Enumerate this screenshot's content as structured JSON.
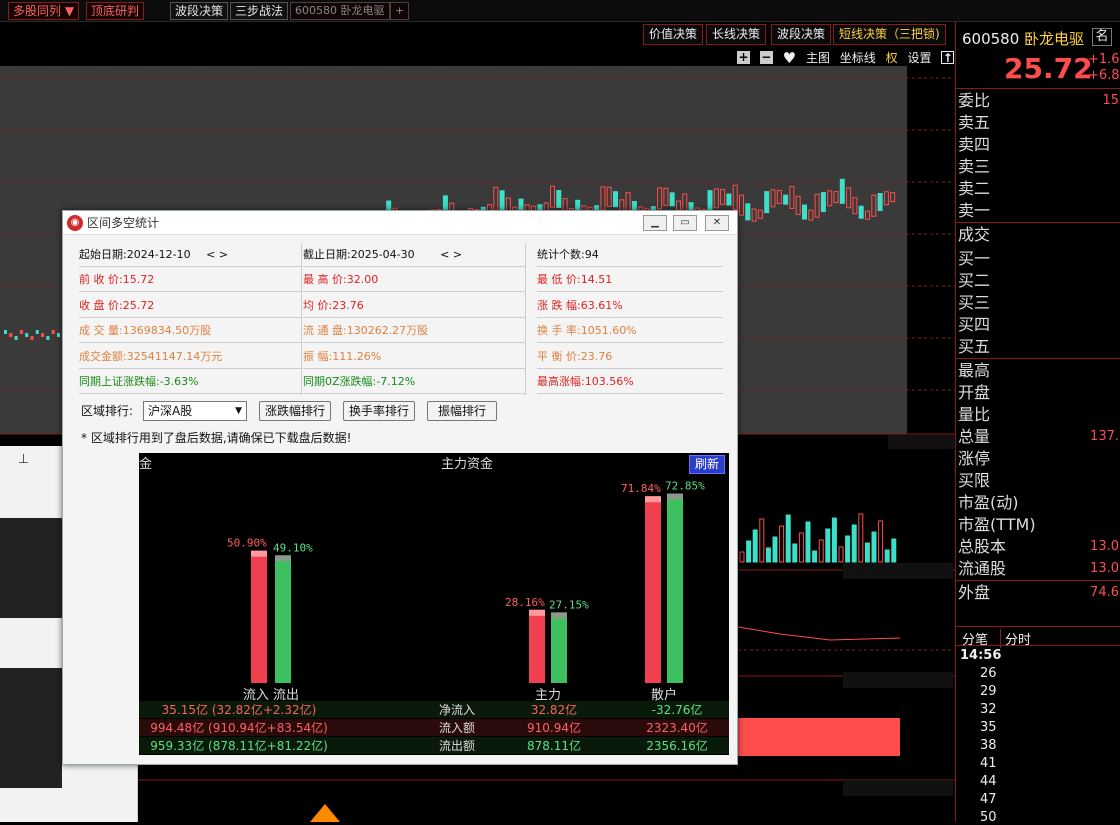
{
  "top_tabs": [
    {
      "label": "多股同列 ▼",
      "style": "red"
    },
    {
      "label": "顶底研判",
      "style": "red"
    },
    {
      "label": "波段决策",
      "style": "white"
    },
    {
      "label": "三步战法",
      "style": "white"
    },
    {
      "label": "600580 卧龙电驱",
      "style": "dim"
    },
    {
      "label": "+",
      "style": "dim"
    }
  ],
  "strategy_buttons": [
    {
      "label": "价值决策",
      "style": "white"
    },
    {
      "label": "长线决策",
      "style": "white"
    },
    {
      "label": "波段决策",
      "style": "white"
    },
    {
      "label": "短线决策（三把锁)",
      "style": "yellow"
    }
  ],
  "chart_tools": {
    "main": "主图",
    "coord": "坐标线",
    "quan": "权",
    "settings": "设置"
  },
  "stock": {
    "code": "600580",
    "name": "卧龙电驱",
    "price": "25.72",
    "change": "+1.6",
    "change_pct": "+6.8",
    "icon": "名"
  },
  "quote_rows": [
    {
      "label": "委比",
      "value": "15"
    },
    {
      "label": "卖五",
      "value": ""
    },
    {
      "label": "卖四",
      "value": ""
    },
    {
      "label": "卖三",
      "value": ""
    },
    {
      "label": "卖二",
      "value": ""
    },
    {
      "label": "卖一",
      "value": ""
    },
    {
      "label": "成交",
      "value": ""
    },
    {
      "label": "买一",
      "value": ""
    },
    {
      "label": "买二",
      "value": ""
    },
    {
      "label": "买三",
      "value": ""
    },
    {
      "label": "买四",
      "value": ""
    },
    {
      "label": "买五",
      "value": ""
    },
    {
      "label": "最高",
      "value": ""
    },
    {
      "label": "开盘",
      "value": ""
    },
    {
      "label": "量比",
      "value": ""
    },
    {
      "label": "总量",
      "value": "137."
    },
    {
      "label": "涨停",
      "value": ""
    },
    {
      "label": "买限",
      "value": ""
    },
    {
      "label": "市盈(动)",
      "value": ""
    },
    {
      "label": "市盈(TTM)",
      "value": ""
    },
    {
      "label": "总股本",
      "value": "13.0"
    },
    {
      "label": "流通股",
      "value": "13.0"
    },
    {
      "label": "外盘",
      "value": "74.6"
    }
  ],
  "tick_tabs": [
    "分笔",
    "分时"
  ],
  "tick_time": "14:56",
  "tick_values": [
    "26",
    "29",
    "32",
    "35",
    "38",
    "41",
    "44",
    "47",
    "50"
  ],
  "dialog": {
    "title": "区间多空统计",
    "start_date": "起始日期:2024-12-10",
    "end_date": "截止日期:2025-04-30",
    "count": "统计个数:94",
    "rows": [
      [
        "前 收 价:15.72",
        "最 高 价:32.00",
        "最 低 价:14.51"
      ],
      [
        "收 盘 价:25.72",
        "均    价:23.76",
        "涨 跌 幅:63.61%"
      ],
      [
        "成 交 量:1369834.50万股",
        "流 通 盘:130262.27万股",
        "换 手 率:1051.60%"
      ],
      [
        "成交金额:32541147.14万元",
        "振    幅:111.26%",
        "平 衡 价:23.76"
      ],
      [
        "同期上证涨跌幅:-3.63%",
        "同期0Z涨跌幅:-7.12%",
        "最高涨幅:103.56%"
      ]
    ],
    "rank_label": "区域排行:",
    "market_select": "沪深A股",
    "rank_buttons": [
      "涨跌幅排行",
      "换手率排行",
      "振幅排行"
    ],
    "note": "* 区域排行用到了盘后数据,请确保已下载盘后数据!"
  },
  "fund": {
    "title": "主力资金",
    "refresh": "刷新",
    "corner": "金",
    "group_labels": [
      "流入 流出",
      "主力",
      "散户"
    ],
    "bar_labels": [
      "50.90%",
      "49.10%",
      "28.16%",
      "27.15%",
      "71.84%",
      "72.85%"
    ],
    "rows": [
      [
        "35.15亿 (32.82亿+2.32亿)",
        "净流入",
        "32.82亿",
        "-32.76亿"
      ],
      [
        "994.48亿 (910.94亿+83.54亿)",
        "流入额",
        "910.94亿",
        "2323.40亿"
      ],
      [
        "959.33亿 (878.11亿+81.22亿)",
        "流出额",
        "878.11亿",
        "2356.16亿"
      ]
    ]
  },
  "chart_data": {
    "type": "bar",
    "title": "主力资金",
    "categories": [
      "流入 流出",
      "主力",
      "散户"
    ],
    "series": [
      {
        "name": "流入",
        "values": [
          50.9,
          28.16,
          71.84
        ],
        "color": "#f04050"
      },
      {
        "name": "流出",
        "values": [
          49.1,
          27.15,
          72.85
        ],
        "color": "#3cc060"
      }
    ],
    "ylim": [
      0,
      80
    ]
  },
  "colors": {
    "up": "#ff4d4d",
    "down": "#3ce0c8",
    "accent": "#8a1a1a",
    "yellow": "#ffd23a"
  }
}
